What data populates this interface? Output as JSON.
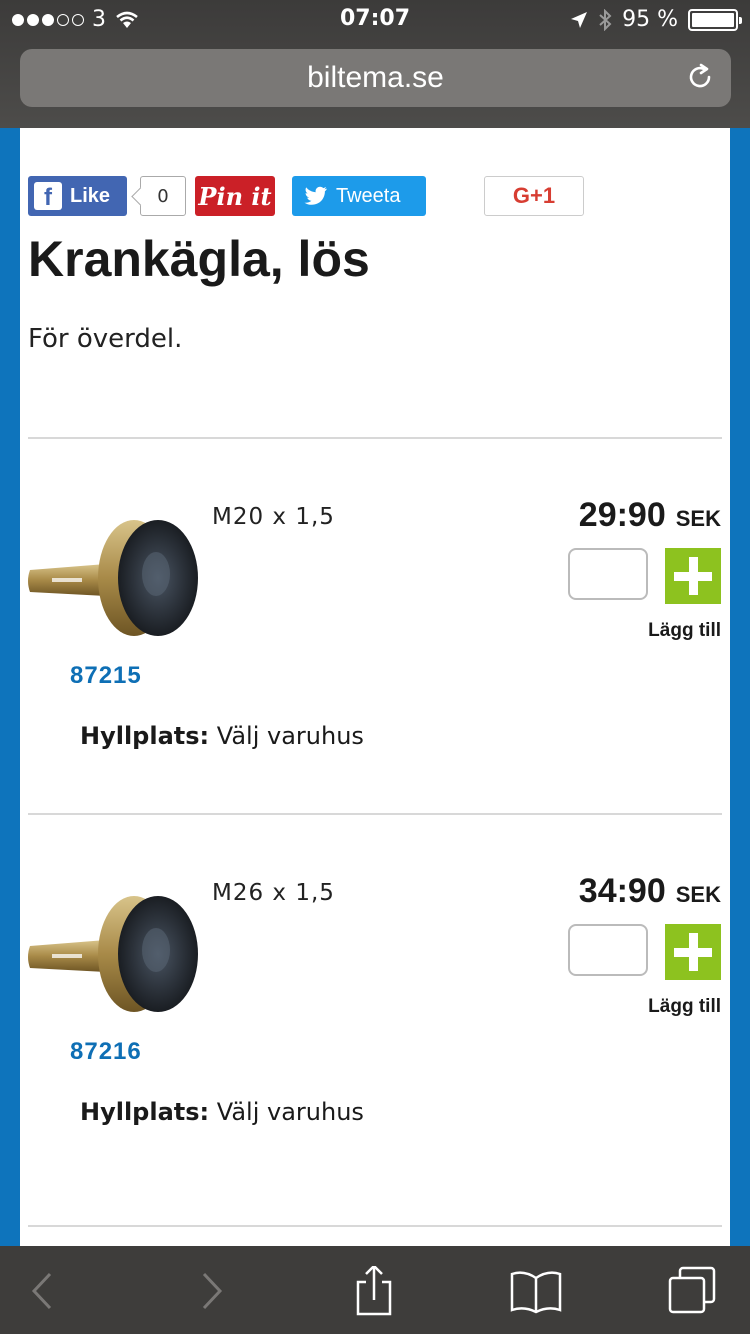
{
  "status_bar": {
    "carrier": "3",
    "time": "07:07",
    "battery": "95 %",
    "battery_level": 0.95,
    "icons": [
      "signal-dots",
      "wifi-icon",
      "location-icon",
      "bluetooth-icon",
      "battery-icon"
    ]
  },
  "browser": {
    "url": "biltema.se",
    "reload_icon": "reload-icon"
  },
  "social": {
    "like_label": "Like",
    "like_count": "0",
    "pin_label": "Pin it",
    "tweet_label": "Tweeta",
    "gplus_label": "G+1"
  },
  "product": {
    "title": "Krankägla, lös",
    "description": "För överdel."
  },
  "variants": [
    {
      "spec": "M20 x 1,5",
      "price": "29:90",
      "currency": "SEK",
      "add_label": "Lägg till",
      "article_no": "87215",
      "shelf_label": "Hyllplats:",
      "shelf_value": "Välj varuhus"
    },
    {
      "spec": "M26 x 1,5",
      "price": "34:90",
      "currency": "SEK",
      "add_label": "Lägg till",
      "article_no": "87216",
      "shelf_label": "Hyllplats:",
      "shelf_value": "Välj varuhus"
    }
  ],
  "colors": {
    "brand_blue": "#0e74bc",
    "add_green": "#8dc21f",
    "link_blue": "#0e6fb5",
    "facebook": "#4266b2",
    "pinterest": "#cb2027",
    "twitter": "#1d9bea",
    "gplus": "#d73d32"
  },
  "toolbar": {
    "icons": [
      "back-icon",
      "forward-icon",
      "share-icon",
      "bookmarks-icon",
      "tabs-icon"
    ]
  }
}
